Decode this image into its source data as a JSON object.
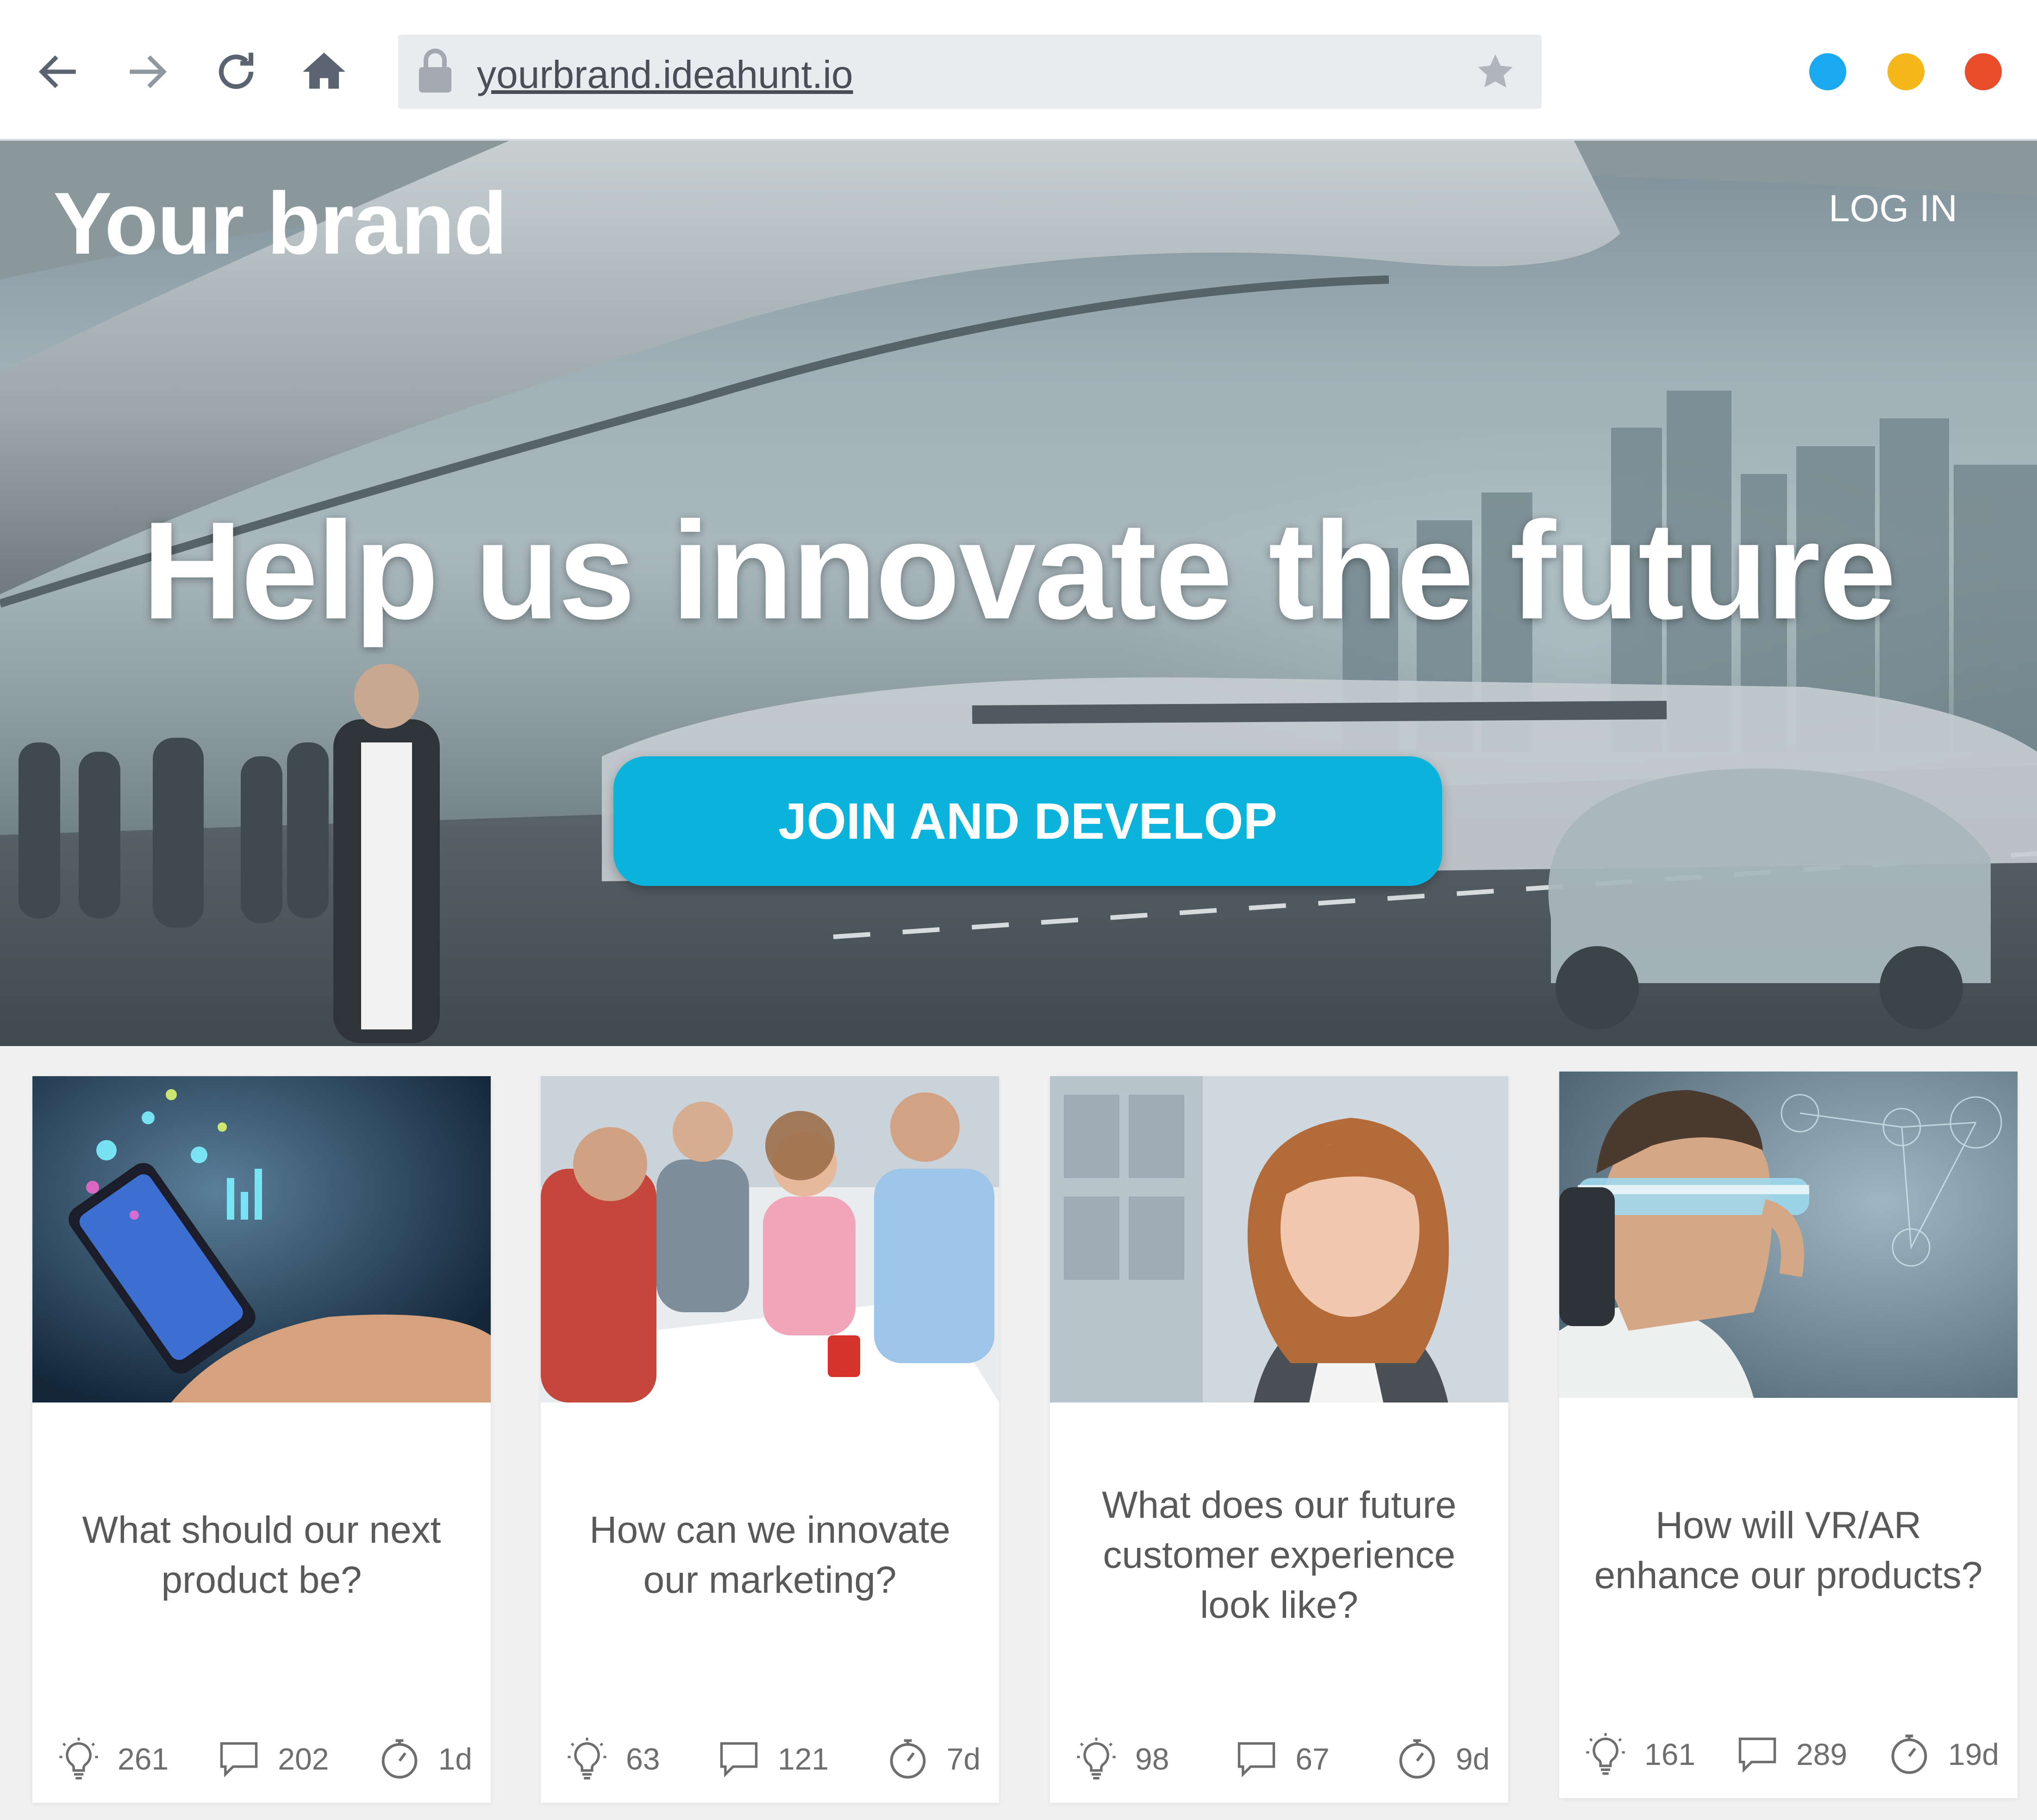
{
  "browser": {
    "url": "yourbrand.ideahunt.io",
    "window_dots": [
      "#1aa8ee",
      "#f5b719",
      "#e84e2b"
    ]
  },
  "header": {
    "brand": "Your brand",
    "login_label": "LOG IN"
  },
  "hero": {
    "headline": "Help us innovate the future",
    "cta_label": "JOIN AND DEVELOP",
    "accent_color": "#0ab3dc"
  },
  "challenges": [
    {
      "title": "What should our next product be?",
      "ideas": "261",
      "comments": "202",
      "time_left": "1d"
    },
    {
      "title": "How can we innovate our marketing?",
      "ideas": "63",
      "comments": "121",
      "time_left": "7d"
    },
    {
      "title": "What does our future customer experience look like?",
      "ideas": "98",
      "comments": "67",
      "time_left": "9d"
    },
    {
      "title": "How will VR/AR enhance our products?",
      "ideas": "161",
      "comments": "289",
      "time_left": "19d"
    }
  ],
  "icons": {
    "ideas": "lightbulb-icon",
    "comments": "comment-bubble-icon",
    "time": "stopwatch-icon"
  }
}
